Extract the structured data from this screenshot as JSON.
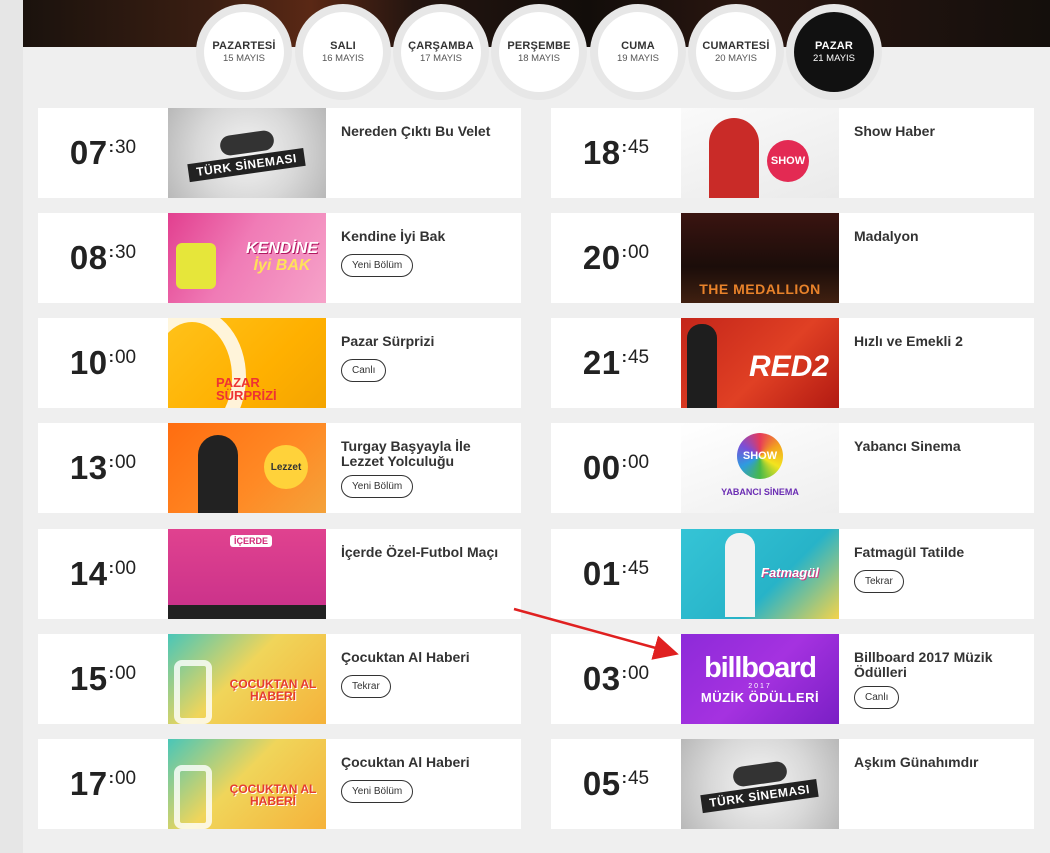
{
  "days": [
    {
      "name": "PAZARTESİ",
      "date": "15 MAYIS"
    },
    {
      "name": "SALI",
      "date": "16 MAYIS"
    },
    {
      "name": "ÇARŞAMBA",
      "date": "17 MAYIS"
    },
    {
      "name": "PERŞEMBE",
      "date": "18 MAYIS"
    },
    {
      "name": "CUMA",
      "date": "19 MAYIS"
    },
    {
      "name": "CUMARTESİ",
      "date": "20 MAYIS"
    },
    {
      "name": "PAZAR",
      "date": "21 MAYIS",
      "active": true
    }
  ],
  "left": [
    {
      "hour": "07",
      "min": "30",
      "title": "Nereden Çıktı Bu Velet",
      "badge": "",
      "thumb_text": "TÜRK SİNEMASI"
    },
    {
      "hour": "08",
      "min": "30",
      "title": "Kendine İyi Bak",
      "badge": "Yeni Bölüm",
      "thumb_text": "KENDİNE",
      "thumb_text2": "İyi BAK"
    },
    {
      "hour": "10",
      "min": "00",
      "title": "Pazar Sürprizi",
      "badge": "Canlı",
      "thumb_text": "PAZAR",
      "thumb_text2": "SÜRPRİZİ"
    },
    {
      "hour": "13",
      "min": "00",
      "title": "Turgay Başyayla İle Lezzet Yolculuğu",
      "badge": "Yeni Bölüm",
      "thumb_text": "Lezzet"
    },
    {
      "hour": "14",
      "min": "00",
      "title": "İçerde Özel-Futbol Maçı",
      "badge": "",
      "thumb_text": "İÇERDE"
    },
    {
      "hour": "15",
      "min": "00",
      "title": "Çocuktan Al Haberi",
      "badge": "Tekrar",
      "thumb_text": "ÇOCUKTAN AL HABERİ"
    },
    {
      "hour": "17",
      "min": "00",
      "title": "Çocuktan Al Haberi",
      "badge": "Yeni Bölüm",
      "thumb_text": "ÇOCUKTAN AL HABERİ"
    }
  ],
  "right": [
    {
      "hour": "18",
      "min": "45",
      "title": "Show Haber",
      "badge": "",
      "thumb_text": "SHOW"
    },
    {
      "hour": "20",
      "min": "00",
      "title": "Madalyon",
      "badge": "",
      "thumb_text": "THE MEDALLION"
    },
    {
      "hour": "21",
      "min": "45",
      "title": "Hızlı ve Emekli 2",
      "badge": "",
      "thumb_text": "RED2"
    },
    {
      "hour": "00",
      "min": "00",
      "title": "Yabancı Sinema",
      "badge": "",
      "thumb_text": "SHOW",
      "thumb_text2": "YABANCI SİNEMA"
    },
    {
      "hour": "01",
      "min": "45",
      "title": "Fatmagül Tatilde",
      "badge": "Tekrar",
      "thumb_text": "Fatmagül"
    },
    {
      "hour": "03",
      "min": "00",
      "title": "Billboard 2017 Müzik Ödülleri",
      "badge": "Canlı",
      "thumb_text": "billboard",
      "thumb_text2": "2017",
      "thumb_text3": "MÜZİK ÖDÜLLERİ"
    },
    {
      "hour": "05",
      "min": "45",
      "title": "Aşkım Günahımdır",
      "badge": "",
      "thumb_text": "TÜRK SİNEMASI"
    }
  ],
  "annotation": {
    "color": "#e02020",
    "icon": "red-arrow-icon"
  }
}
